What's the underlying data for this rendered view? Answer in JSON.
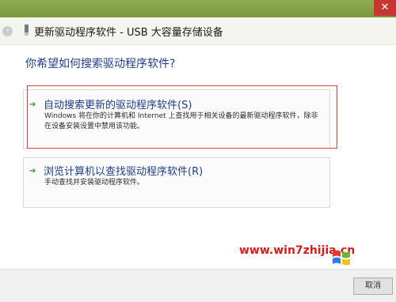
{
  "window": {
    "title": "更新驱动程序软件 - USB 大容量存储设备",
    "close_glyph": "✕",
    "back_glyph": "‹"
  },
  "main": {
    "question": "你希望如何搜索驱动程序软件?",
    "options": [
      {
        "title": "自动搜索更新的驱动程序软件(S)",
        "description": "Windows 将在你的计算机和 Internet 上查找用于相关设备的最新驱动程序软件，除非在设备安装设置中禁用该功能。"
      },
      {
        "title": "浏览计算机以查找驱动程序软件(R)",
        "description": "手动查找并安装驱动程序软件。"
      }
    ]
  },
  "footer": {
    "cancel_label": "取消"
  },
  "watermark": {
    "url": "www.win7zhijia.cn",
    "logo": "WiN7之家"
  },
  "colors": {
    "accent": "#1f3e8a",
    "highlight": "#e53a3a",
    "frame": "#7a9a3e"
  }
}
